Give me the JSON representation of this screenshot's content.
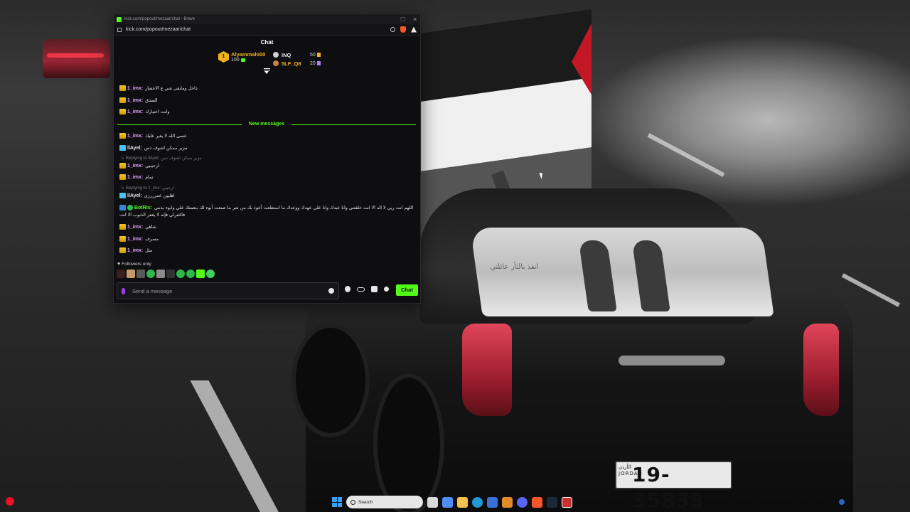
{
  "window": {
    "title": "kick.com/popout/mezaar/chat - Brave",
    "url": "kick.com/popout/mezaar/chat"
  },
  "chat": {
    "header": "Chat",
    "leaderboard": {
      "top": {
        "rank": "1",
        "name": "Alyammahi00",
        "amount": "100"
      },
      "others": [
        {
          "name": "INQ",
          "points": "50",
          "color": "#e6e6e6"
        },
        {
          "name": "5LF_Q8",
          "points": "20",
          "color": "#f2b21b"
        }
      ]
    },
    "messages_before": [
      {
        "user": "1_imx:",
        "text": "داخل ومابقى شي ع الاعصار",
        "user_color": "#e6a3ff"
      },
      {
        "user": "1_imx:",
        "text": "الصدق",
        "user_color": "#e6a3ff"
      },
      {
        "user": "1_imx:",
        "text": "وانت اختيارك",
        "user_color": "#e6a3ff"
      }
    ],
    "new_messages_label": "New messages",
    "messages_after": [
      {
        "user": "1_imx:",
        "text": "عسى الله لا يغير عليك",
        "user_color": "#e6a3ff"
      },
      {
        "user": "llAyel:",
        "text": "مزبر ممكن اشوف دس",
        "user_color": "#e6e6e6"
      },
      {
        "reply": "Replying to llAyel:",
        "reply_quote": "مزبر ممكن اشوف دس"
      },
      {
        "user": "1_imx:",
        "text": "ارحيبيي",
        "user_color": "#e6a3ff"
      },
      {
        "user": "1_imx:",
        "text": "تمام",
        "user_color": "#e6a3ff"
      },
      {
        "reply": "Replying to 1_imx:",
        "reply_quote": "ارحيبي"
      },
      {
        "user": "llAyel:",
        "text": "اهليين عمرررري",
        "user_color": "#e6e6e6"
      },
      {
        "user": "BotRix:",
        "text": "اللهم انت ربي لا اله الا انت خلقتني وانا عبدك وانا على عهدك ووعدك ما استطعت أعوذ بك من شر ما صنعت أبوء لك بنعمتك علي وابوء بذنبي",
        "text2": "فاغفرلي فإنه لا يغفر الذنوب الا انت",
        "user_color": "#53fc18"
      },
      {
        "user": "1_imx:",
        "text": "شاهي",
        "user_color": "#e6a3ff"
      },
      {
        "user": "1_imx:",
        "text": "مسرف",
        "user_color": "#e6a3ff"
      },
      {
        "user": "1_imx:",
        "text": "مثل",
        "user_color": "#e6a3ff"
      }
    ],
    "followers_only": "Followers only",
    "composer": {
      "placeholder": "Send a message"
    },
    "send_label": "Chat"
  },
  "wallpaper": {
    "plate_number": "19-35833",
    "plate_country": "الأردن JORDAN",
    "window_text": "انقذ بالثأر عائلتي"
  },
  "taskbar": {
    "search_placeholder": "Search"
  },
  "colors": {
    "kick_green": "#53fc18",
    "gold": "#f2b21b",
    "background": "#0e0e10"
  }
}
